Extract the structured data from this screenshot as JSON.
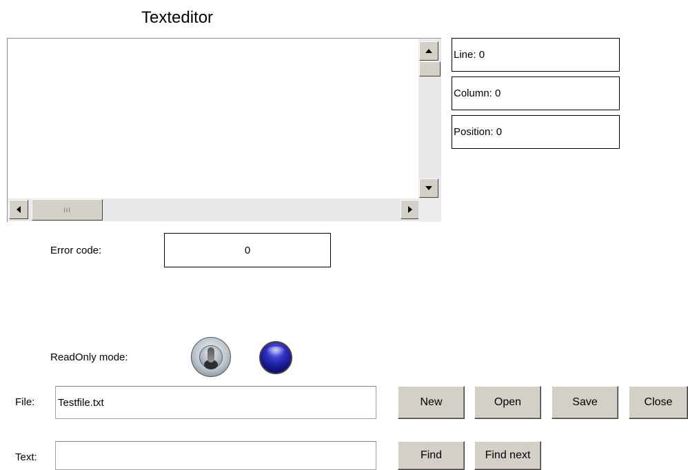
{
  "app": {
    "title": "Texteditor"
  },
  "editor": {
    "content": "",
    "hscroll_thumb_grip": "III"
  },
  "status": {
    "line": "Line: 0",
    "column": "Column: 0",
    "position": "Position: 0"
  },
  "error": {
    "label": "Error code:",
    "value": "0"
  },
  "readonly": {
    "label": "ReadOnly mode:",
    "switch_state": "off",
    "led_color": "#1a1aa0"
  },
  "file": {
    "label": "File:",
    "value": "Testfile.txt",
    "placeholder": ""
  },
  "text": {
    "label": "Text:",
    "value": "",
    "placeholder": ""
  },
  "buttons": {
    "new": "New",
    "open": "Open",
    "save": "Save",
    "close": "Close",
    "find": "Find",
    "find_next": "Find next"
  },
  "icons": {
    "scroll_up": "arrow-up",
    "scroll_down": "arrow-down",
    "scroll_left": "arrow-left",
    "scroll_right": "arrow-right",
    "switch": "toggle-knob",
    "indicator": "led"
  }
}
